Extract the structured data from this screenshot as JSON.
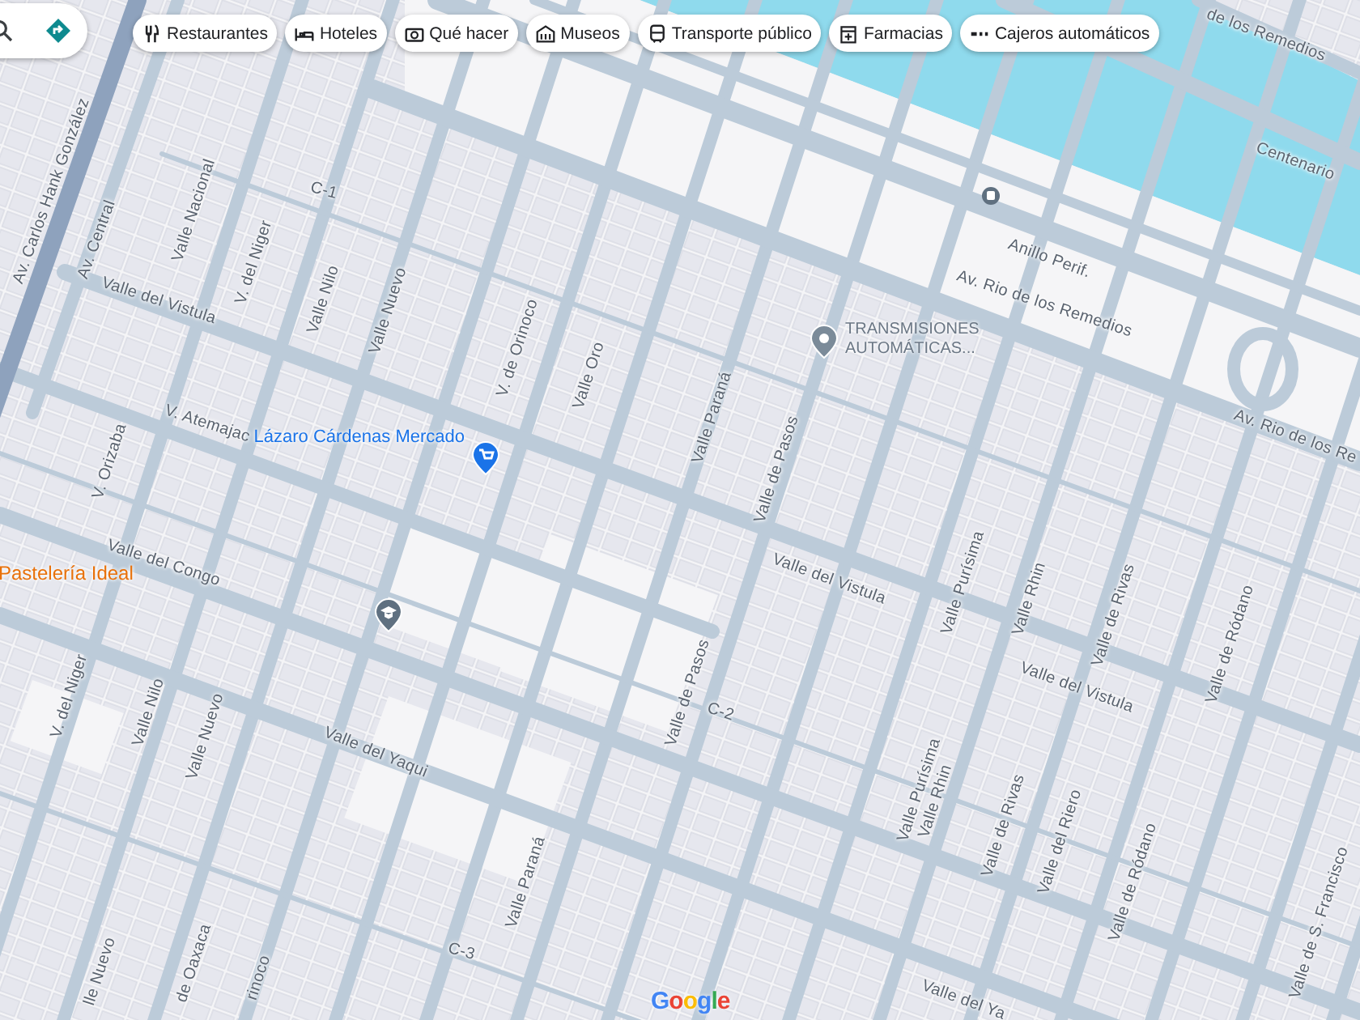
{
  "search_box": {
    "has_search": true,
    "has_directions": true
  },
  "chips": [
    {
      "label": "Restaurantes",
      "kind": "restaurant"
    },
    {
      "label": "Hoteles",
      "kind": "hotel"
    },
    {
      "label": "Qué hacer",
      "kind": "camera"
    },
    {
      "label": "Museos",
      "kind": "museum"
    },
    {
      "label": "Transporte público",
      "kind": "transit"
    },
    {
      "label": "Farmacias",
      "kind": "pharmacy"
    },
    {
      "label": "Cajeros automáticos",
      "kind": "atm"
    }
  ],
  "street_labels": [
    {
      "text": "Av. Carlos Hank González"
    },
    {
      "text": "Av. Central"
    },
    {
      "text": "Valle Nacional"
    },
    {
      "text": "V. del Niger"
    },
    {
      "text": "Valle Nilo"
    },
    {
      "text": "Valle Nuevo"
    },
    {
      "text": "V. de Orinoco"
    },
    {
      "text": "Valle Oro"
    },
    {
      "text": "Valle Paraná"
    },
    {
      "text": "Valle de Pasos"
    },
    {
      "text": "Valle del Vistula"
    },
    {
      "text": "V. Atemajac"
    },
    {
      "text": "V. Orizaba"
    },
    {
      "text": "Valle del Congo"
    },
    {
      "text": "C-1"
    },
    {
      "text": "Av. Rio de los Remedios"
    },
    {
      "text": "Av. Rio de los Re"
    },
    {
      "text": "Anillo Perif."
    },
    {
      "text": "Centenario"
    },
    {
      "text": "de los Remedios"
    },
    {
      "text": "Valle del Vistula"
    },
    {
      "text": "Valle del Vistula"
    },
    {
      "text": "Valle Purísima"
    },
    {
      "text": "Valle Purísima"
    },
    {
      "text": "Valle Rhin"
    },
    {
      "text": "Valle Rhin"
    },
    {
      "text": "Valle de Rivas"
    },
    {
      "text": "Valle de Rivas"
    },
    {
      "text": "Valle del Riero"
    },
    {
      "text": "Valle de Ródano"
    },
    {
      "text": "Valle de Ródano"
    },
    {
      "text": "Valle de S. Francisco"
    },
    {
      "text": "Valle de Pasos"
    },
    {
      "text": "C-2"
    },
    {
      "text": "Valle del Yaqui"
    },
    {
      "text": "Valle del Ya"
    },
    {
      "text": "V. del Niger"
    },
    {
      "text": "Valle Nilo"
    },
    {
      "text": "Valle Nuevo"
    },
    {
      "text": "lle Nuevo"
    },
    {
      "text": "de Oaxaca"
    },
    {
      "text": "rinoco"
    },
    {
      "text": "Valle Paraná"
    },
    {
      "text": "C-3"
    }
  ],
  "places": [
    {
      "kind": "market",
      "name": "Lázaro Cárdenas Mercado"
    },
    {
      "kind": "pin",
      "name": "TRANSMISIONES AUTOMÁTICAS..."
    },
    {
      "kind": "food",
      "name": "Pastelería Ideal"
    },
    {
      "kind": "school"
    },
    {
      "kind": "bus"
    }
  ],
  "logo": "Google"
}
